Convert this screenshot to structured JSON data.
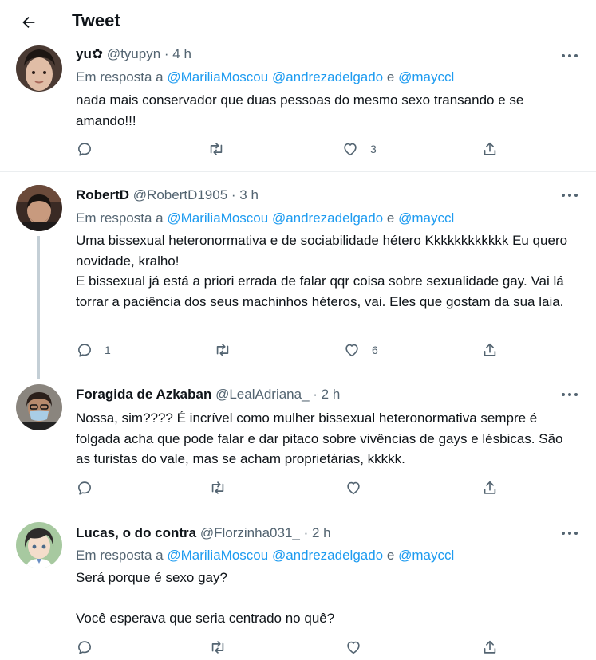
{
  "header": {
    "title": "Tweet",
    "back_icon": "arrow-left-icon"
  },
  "reply_prefix": "Em resposta a",
  "reply_joiner": "e",
  "tweets": [
    {
      "name": "yu✿",
      "handle": "@tyupyn",
      "time": "· 4 h",
      "mentions": [
        "@MariliaMoscou",
        "@andrezadelgado",
        "@mayccl"
      ],
      "text": "nada mais conservador que duas pessoas do mesmo sexo transando e se amando!!!",
      "reply_count": "",
      "retweet_count": "",
      "like_count": "3"
    },
    {
      "name": "RobertD",
      "handle": "@RobertD1905",
      "time": "· 3 h",
      "mentions": [
        "@MariliaMoscou",
        "@andrezadelgado",
        "@mayccl"
      ],
      "text": "Uma bissexual heteronormativa e de sociabilidade hétero Kkkkkkkkkkkk Eu quero novidade, kralho!\nE bissexual já está a priori errada de falar qqr coisa sobre sexualidade gay. Vai lá torrar a paciência dos seus machinhos héteros, vai. Eles que gostam da sua laia.",
      "reply_count": "1",
      "retweet_count": "",
      "like_count": "6"
    },
    {
      "name": "Foragida de Azkaban",
      "handle": "@LealAdriana_",
      "time": "· 2 h",
      "mentions": [],
      "text": "Nossa, sim???? É incrível como mulher bissexual heteronormativa sempre é folgada acha que pode falar e dar pitaco sobre vivências de gays e lésbicas. São as turistas do vale, mas se acham proprietárias, kkkkk.",
      "reply_count": "",
      "retweet_count": "",
      "like_count": ""
    },
    {
      "name": "Lucas, o do contra",
      "handle": "@Florzinha031_",
      "time": "· 2 h",
      "mentions": [
        "@MariliaMoscou",
        "@andrezadelgado",
        "@mayccl"
      ],
      "text": "Será porque é sexo gay?\n\nVocê esperava que seria centrado no quê?",
      "reply_count": "",
      "retweet_count": "",
      "like_count": ""
    }
  ],
  "icons": {
    "reply": "reply-icon",
    "retweet": "retweet-icon",
    "like": "heart-icon",
    "share": "share-icon",
    "more": "more-icon"
  },
  "colors": {
    "accent": "#1d9bf0",
    "secondary_text": "#536471",
    "divider": "#ebeef0",
    "thread_line": "#c4cfd6"
  }
}
